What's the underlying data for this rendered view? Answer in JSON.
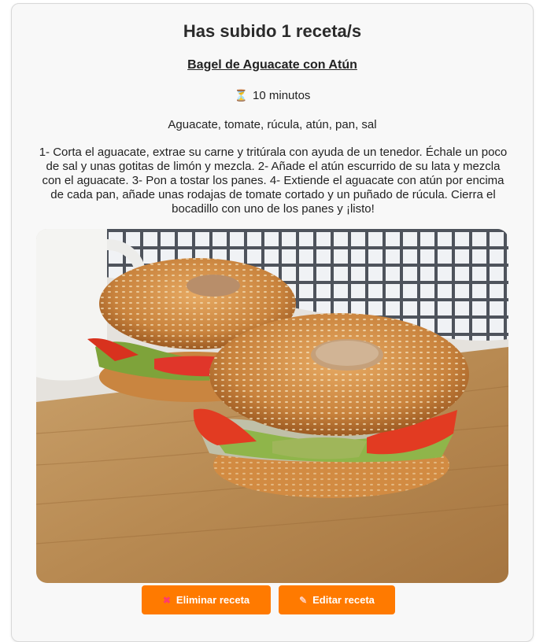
{
  "header": {
    "title": "Has subido 1 receta/s"
  },
  "recipe": {
    "name": "Bagel de Aguacate con Atún",
    "time_icon": "hourglass-icon",
    "time": "10 minutos",
    "ingredients": "Aguacate, tomate, rúcula, atún, pan, sal",
    "steps": "1- Corta el aguacate, extrae su carne y tritúrala con ayuda de un tenedor. Échale un poco de sal y unas gotitas de limón y mezcla. 2- Añade el atún escurrido de su lata y mezcla con el aguacate. 3- Pon a tostar los panes. 4- Extiende el aguacate con atún por encima de cada pan, añade unas rodajas de tomate cortado y un puñado de rúcula. Cierra el bocadillo con uno de los panes y ¡listo!"
  },
  "actions": {
    "delete_label": "Eliminar receta",
    "delete_icon": "cross-icon",
    "edit_label": "Editar receta",
    "edit_icon": "pencil-icon"
  },
  "colors": {
    "accent": "#ff7a00",
    "card_background": "#f8f8f8",
    "text": "#222222"
  }
}
